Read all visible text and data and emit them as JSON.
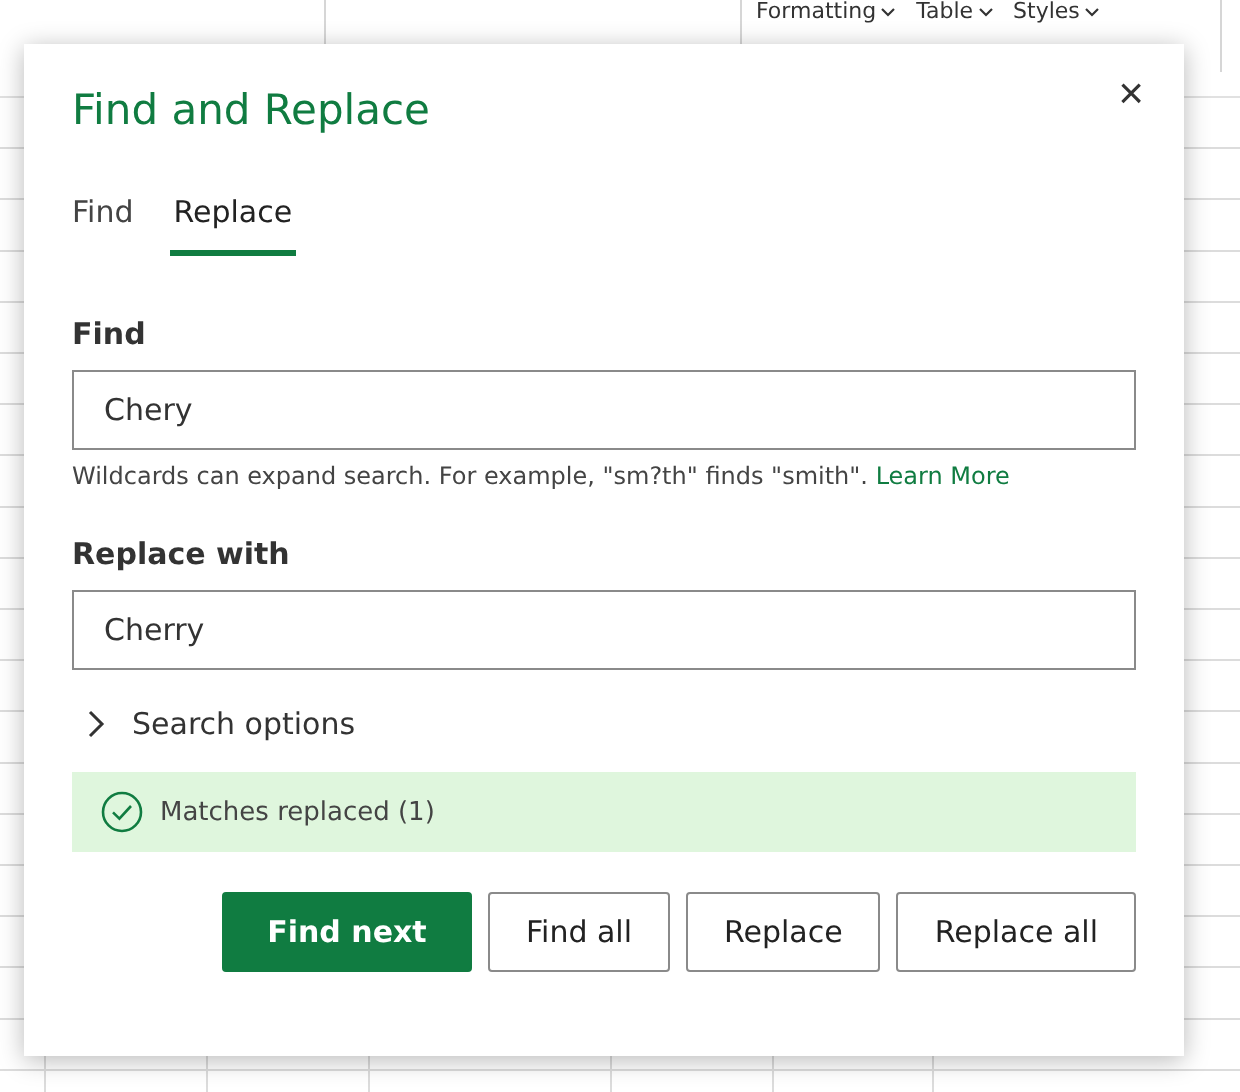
{
  "ribbon": {
    "items": [
      {
        "label": "Formatting"
      },
      {
        "label": "Table"
      },
      {
        "label": "Styles"
      }
    ]
  },
  "dialog": {
    "title": "Find and Replace",
    "close": "×",
    "tabs": [
      {
        "label": "Find",
        "selected": false
      },
      {
        "label": "Replace",
        "selected": true
      }
    ],
    "find": {
      "label": "Find",
      "value": "Chery",
      "hint": "Wildcards can expand search. For example, \"sm?th\" finds \"smith\".",
      "link": "Learn More"
    },
    "replace": {
      "label": "Replace with",
      "value": "Cherry"
    },
    "search_options": {
      "label": "Search options",
      "expanded": false
    },
    "status": {
      "kind": "success",
      "text": "Matches replaced (1)"
    },
    "buttons": [
      {
        "label": "Find next",
        "primary": true
      },
      {
        "label": "Find all",
        "primary": false
      },
      {
        "label": "Replace",
        "primary": false
      },
      {
        "label": "Replace all",
        "primary": false
      }
    ]
  }
}
